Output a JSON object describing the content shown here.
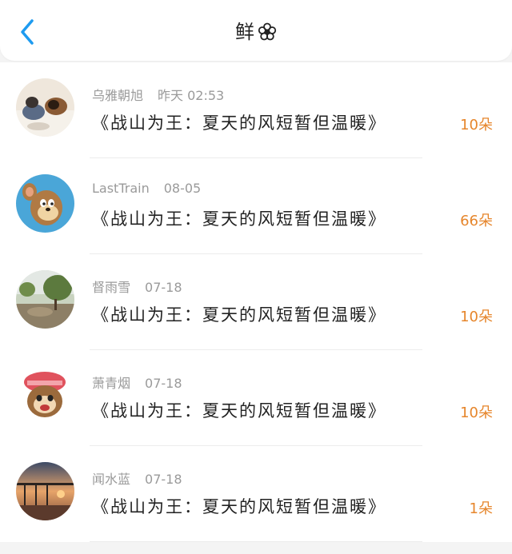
{
  "header": {
    "title": "鲜",
    "back_icon": "chevron-left-icon",
    "title_icon": "flower-icon",
    "accent": "#1e9bf0"
  },
  "items": [
    {
      "name": "乌雅朝旭",
      "time": "昨天 02:53",
      "work": "《战山为王：夏天的风短暂但温暖》",
      "count": "10朵"
    },
    {
      "name": "LastTrain",
      "time": "08-05",
      "work": "《战山为王：夏天的风短暂但温暖》",
      "count": "66朵"
    },
    {
      "name": "督雨雪",
      "time": "07-18",
      "work": "《战山为王：夏天的风短暂但温暖》",
      "count": "10朵"
    },
    {
      "name": "萧青烟",
      "time": "07-18",
      "work": "《战山为王：夏天的风短暂但温暖》",
      "count": "10朵"
    },
    {
      "name": "闻水蓝",
      "time": "07-18",
      "work": "《战山为王：夏天的风短暂但温暖》",
      "count": "1朵"
    }
  ],
  "colors": {
    "count": "#e6862c",
    "meta": "#9a9a9a",
    "text": "#222222"
  }
}
